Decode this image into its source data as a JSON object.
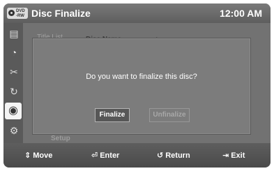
{
  "header": {
    "dvd_line1": "DVD",
    "dvd_line2": "-RW",
    "title": "Disc Finalize",
    "time": "12:00 AM"
  },
  "sidebar": {
    "icons": [
      "film-icon",
      "clock-icon",
      "scissors-icon",
      "copy-icon",
      "disc-icon",
      "gear-icon"
    ],
    "active_index": 4
  },
  "background": {
    "title_list_label": "Title List",
    "disc_name_heading": "Disc Name",
    "disc_name_value": ":",
    "setup_label": "Setup"
  },
  "dialog": {
    "message": "Do you want to finalize this disc?",
    "finalize_label": "Finalize",
    "unfinalize_label": "Unfinalize"
  },
  "footer": {
    "move_icon": "⇕",
    "move_label": "Move",
    "enter_icon": "⏎",
    "enter_label": "Enter",
    "return_icon": "↺",
    "return_label": "Return",
    "exit_icon": "⇥",
    "exit_label": "Exit"
  }
}
